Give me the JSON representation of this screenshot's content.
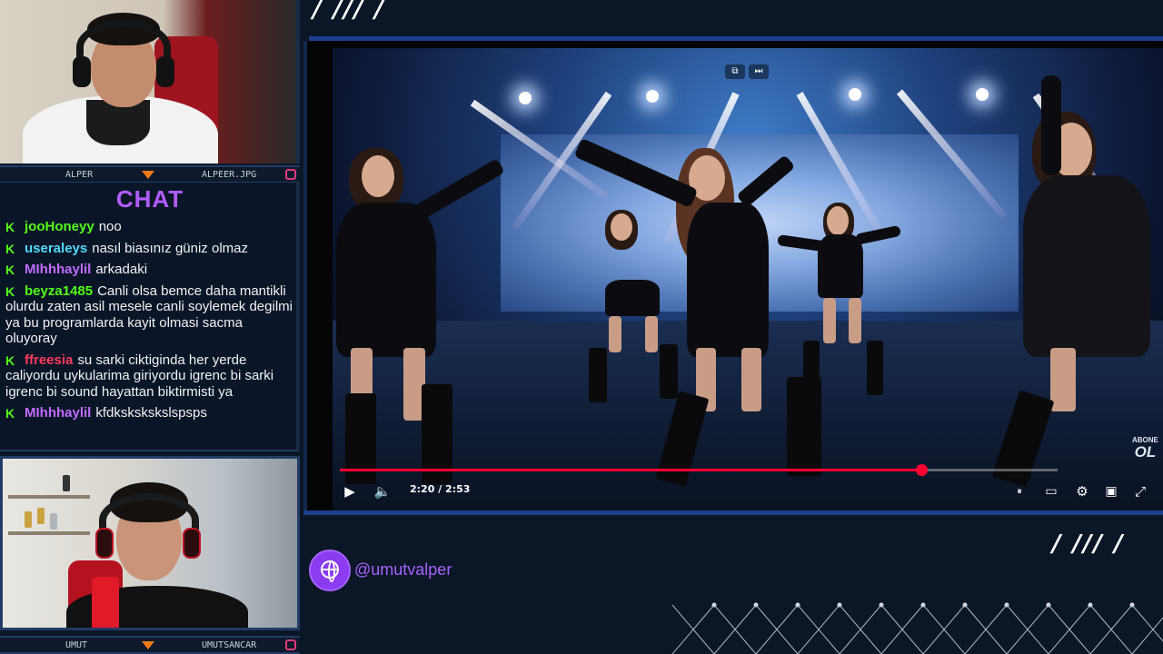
{
  "top_cam": {
    "left_label": "ALPER",
    "right_label": "ALPEER.JPG"
  },
  "bottom_cam": {
    "left_label": "UMUT",
    "right_label": "UMUTSANCAR"
  },
  "chat": {
    "title": "CHAT",
    "badge_icon": "kick-icon",
    "messages": [
      {
        "user": "jooHoneyy",
        "color": "#53fc18",
        "text": "noo"
      },
      {
        "user": "useraleys",
        "color": "#53d8fc",
        "text": "nasıl biasınız güniz olmaz"
      },
      {
        "user": "MIhhhaylil",
        "color": "#c06cff",
        "text": "arkadaki"
      },
      {
        "user": "beyza1485",
        "color": "#53fc18",
        "text": "Canli olsa bemce daha mantikli olurdu zaten asil mesele canli soylemek degilmi ya bu programlarda kayit olmasi sacma oluyoray"
      },
      {
        "user": "ffreesia",
        "color": "#ff3b5c",
        "text": "su sarki ciktiginda her yerde caliyordu uykularima giriyordu igrenc bi sarki igrenc bi sound hayattan biktirmisti ya"
      },
      {
        "user": "MIhhhaylil",
        "color": "#c06cff",
        "text": "kfdkskskskslspsps"
      }
    ]
  },
  "decor": {
    "slashes_top": "/ /// /",
    "slashes_bottom": "/ /// /"
  },
  "player": {
    "time": "2:20 / 2:53",
    "progress": 0.81,
    "abone_small": "ABONE",
    "abone_big": "OL",
    "icons": [
      "play-icon",
      "volume-icon",
      "pause-mini-icon",
      "subtitles-icon",
      "settings-icon",
      "theater-icon",
      "fullscreen-icon"
    ]
  },
  "social": {
    "icon": "globe-icon",
    "handle": "@umutvalper"
  },
  "colors": {
    "accent": "#a761ff",
    "frame": "#1c3f8c",
    "progress": "#ff0033"
  }
}
